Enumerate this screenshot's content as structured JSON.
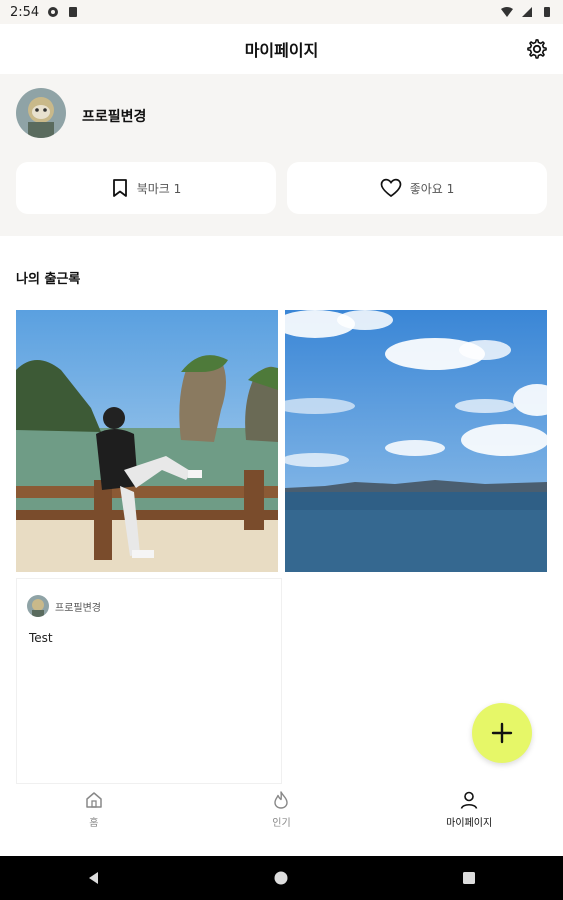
{
  "status_bar": {
    "time": "2:54"
  },
  "header": {
    "title": "마이페이지"
  },
  "profile": {
    "name": "프로필변경"
  },
  "stats": {
    "bookmark_label": "북마크 1",
    "like_label": "좋아요 1"
  },
  "section": {
    "title": "나의 출근록"
  },
  "posts": [
    {
      "author": "프로필변경",
      "text": "Test"
    }
  ],
  "nav": [
    {
      "label": "홈",
      "icon": "home-icon"
    },
    {
      "label": "인기",
      "icon": "flame-icon"
    },
    {
      "label": "마이페이지",
      "icon": "person-icon",
      "active": true
    }
  ],
  "colors": {
    "fab": "#e6f768",
    "profile_bg": "#f6f5f3"
  }
}
